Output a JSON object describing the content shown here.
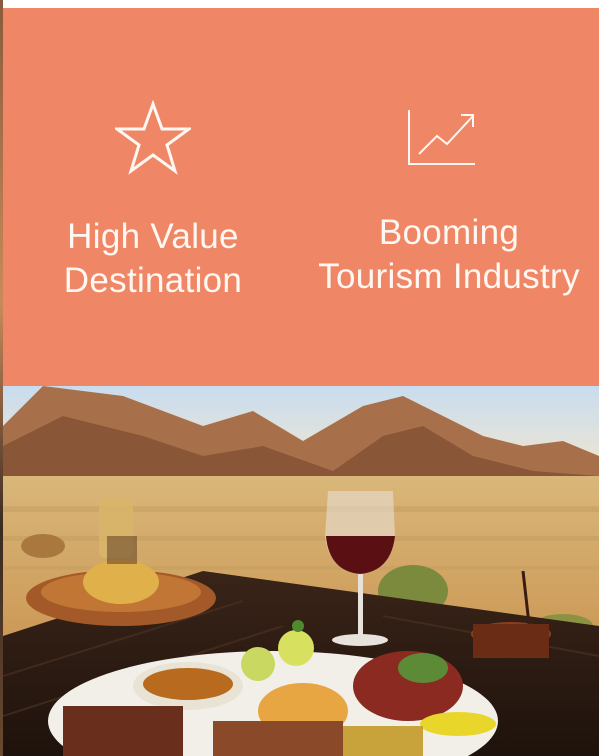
{
  "features": [
    {
      "icon": "star-icon",
      "line1": "High Value",
      "line2": "Destination"
    },
    {
      "icon": "trend-up-icon",
      "line1": "Booming",
      "line2": "Tourism Industry"
    }
  ],
  "colors": {
    "panel": "#ef8766",
    "text": "#fff7f2"
  },
  "photo": {
    "subject": "dining-table-desert-mountains"
  }
}
